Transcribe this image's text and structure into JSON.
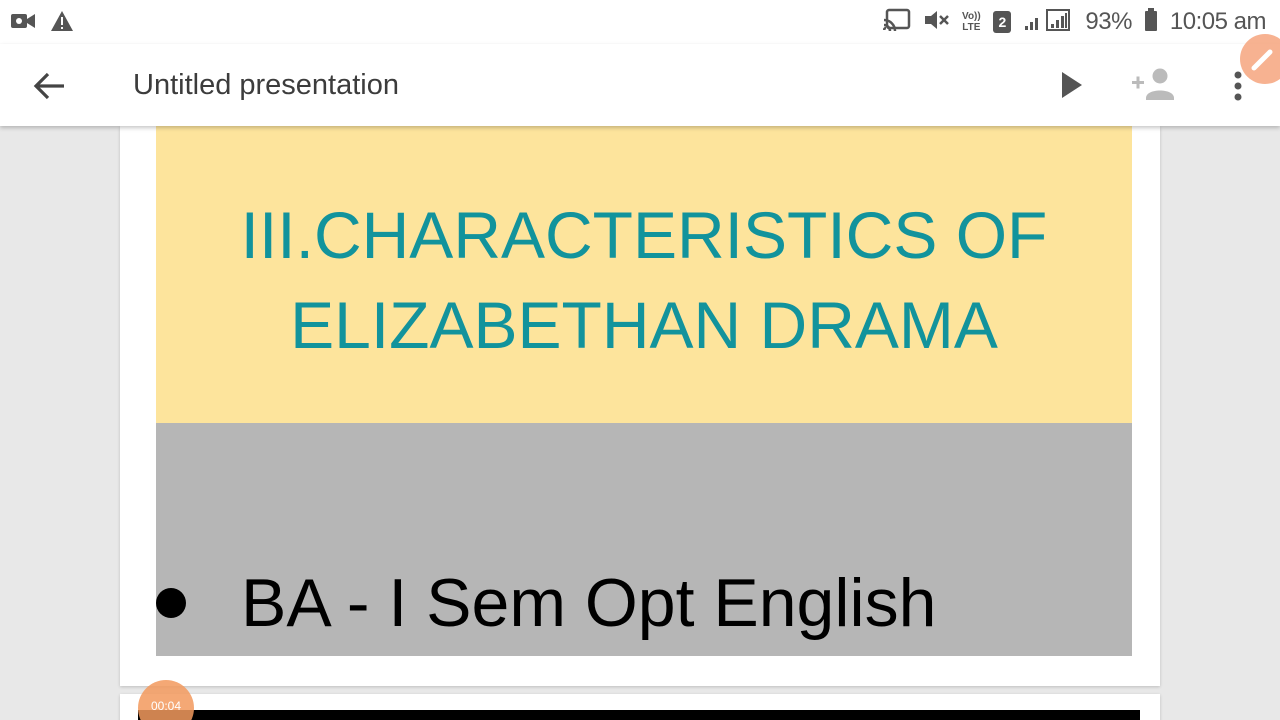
{
  "status_bar": {
    "battery": "93%",
    "time": "10:05 am",
    "sim_slot": "2",
    "volte_label": "Vo)) LTE",
    "icons": [
      "video-camera-icon",
      "warning-icon",
      "cast-icon",
      "mute-icon",
      "volte-icon",
      "sim-icon",
      "signal-icon",
      "battery-icon"
    ]
  },
  "app_bar": {
    "title": "Untitled presentation",
    "icons": [
      "back-arrow-icon",
      "play-icon",
      "add-person-icon",
      "more-vert-icon",
      "edit-icon"
    ]
  },
  "slide": {
    "title_line1": "III.CHARACTERISTICS OF",
    "title_line2": "ELIZABETHAN DRAMA",
    "bullet_text": "BA - I Sem Opt English",
    "colors": {
      "title_bg": "#fde49c",
      "title_text": "#12939c",
      "body_bg": "#b6b6b6"
    }
  },
  "recording": {
    "timer": "00:04"
  }
}
